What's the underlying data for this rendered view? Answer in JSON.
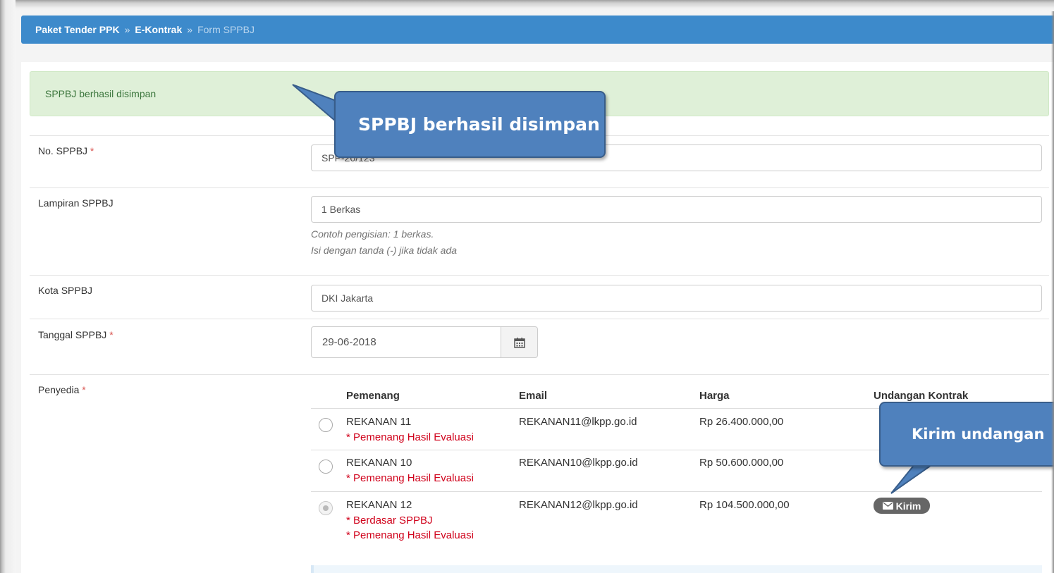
{
  "breadcrumb": {
    "items": [
      "Paket Tender PPK",
      "E-Kontrak",
      "Form SPPBJ"
    ],
    "separator": "»"
  },
  "alert": {
    "message": "SPPBJ berhasil disimpan"
  },
  "form": {
    "no_sppbj": {
      "label": "No. SPPBJ",
      "required_mark": "*",
      "value": "SPP-20/123"
    },
    "lampiran": {
      "label": "Lampiran SPPBJ",
      "value": "1 Berkas",
      "help_line1": "Contoh pengisian: 1 berkas.",
      "help_line2": "Isi dengan tanda (-) jika tidak ada"
    },
    "kota": {
      "label": "Kota SPPBJ",
      "value": "DKI Jakarta"
    },
    "tanggal": {
      "label": "Tanggal SPPBJ",
      "required_mark": "*",
      "value": "29-06-2018",
      "button_icon": "calendar-icon"
    },
    "penyedia": {
      "label": "Penyedia",
      "required_mark": "*"
    }
  },
  "table": {
    "headers": [
      "Pemenang",
      "Email",
      "Harga",
      "Undangan Kontrak"
    ],
    "rows": [
      {
        "name": "REKANAN 11",
        "email": "REKANAN11@lkpp.go.id",
        "harga": "Rp 26.400.000,00",
        "notes": [
          "* Pemenang Hasil Evaluasi"
        ],
        "selected": false
      },
      {
        "name": "REKANAN 10",
        "email": "REKANAN10@lkpp.go.id",
        "harga": "Rp 50.600.000,00",
        "notes": [
          "* Pemenang Hasil Evaluasi"
        ],
        "selected": false
      },
      {
        "name": "REKANAN 12",
        "email": "REKANAN12@lkpp.go.id",
        "harga": "Rp 104.500.000,00",
        "notes": [
          "* Berdasar SPPBJ",
          "* Pemenang Hasil Evaluasi"
        ],
        "selected": true,
        "action_label": "Kirim",
        "action_icon": "envelope-icon"
      }
    ]
  },
  "callouts": {
    "saved": "SPPBJ berhasil disimpan",
    "send": "Kirim undangan"
  },
  "colors": {
    "breadcrumb_bg": "#3d8acb",
    "alert_bg": "#dff0d8",
    "alert_text": "#3c763d",
    "required": "#d9534f",
    "note_red": "#d0021b",
    "callout_fill": "#4f81bd"
  }
}
